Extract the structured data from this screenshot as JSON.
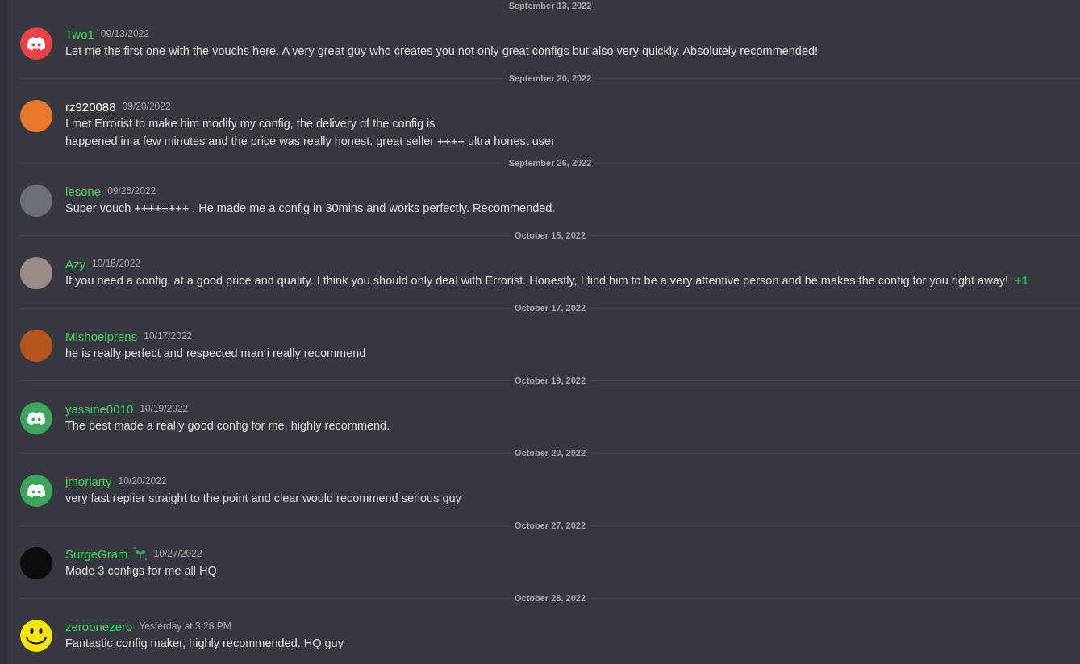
{
  "messages": [
    {
      "divider": "September 13, 2022",
      "author": "Two1",
      "color": "#43d35a",
      "timestamp": "09/13/2022",
      "avatar": {
        "kind": "discord",
        "color": "#ed4245"
      },
      "has_badge": false,
      "lines": [
        "Let me the first one with the vouchs here. A very great guy who creates you not only great configs but also very quickly. Absolutely recommended!"
      ]
    },
    {
      "divider": "September 20, 2022",
      "author": "rz920088",
      "color": "#ffffff",
      "timestamp": "09/20/2022",
      "avatar": {
        "kind": "photo",
        "color": "#e8792c"
      },
      "has_badge": false,
      "lines": [
        "I met Errorist to make him modify my config, the delivery of the config is",
        "happened in a few minutes and the price was really honest. great seller ++++ ultra honest user"
      ]
    },
    {
      "divider": "September 26, 2022",
      "author": "lesone",
      "color": "#43d35a",
      "timestamp": "09/26/2022",
      "avatar": {
        "kind": "photo",
        "color": "#6b7078"
      },
      "has_badge": false,
      "lines": [
        "Super vouch ++++++++ . He made me a config in 30mins and works perfectly. Recommended."
      ]
    },
    {
      "divider": "October 15, 2022",
      "author": "Azy",
      "color": "#43d35a",
      "timestamp": "10/15/2022",
      "avatar": {
        "kind": "photo",
        "color": "#9a8b86"
      },
      "has_badge": false,
      "lines": [
        "If you need a config, at a good price and quality. I think you should only deal with Errorist. Honestly, I find him to be a very attentive person and he makes the config for you right away!"
      ],
      "emoji": "+1"
    },
    {
      "divider": "October 17, 2022",
      "author": "Mishoelprens",
      "color": "#43d35a",
      "timestamp": "10/17/2022",
      "avatar": {
        "kind": "photo",
        "color": "#b5541c"
      },
      "has_badge": false,
      "lines": [
        "he is really perfect and respected man i really recommend"
      ]
    },
    {
      "divider": "October 19, 2022",
      "author": "yassine0010",
      "color": "#43d35a",
      "timestamp": "10/19/2022",
      "avatar": {
        "kind": "discord",
        "color": "#3ba55c"
      },
      "has_badge": false,
      "lines": [
        "The best made a really good config for me, highly recommend."
      ]
    },
    {
      "divider": "October 20, 2022",
      "author": "jmoriarty",
      "color": "#43d35a",
      "timestamp": "10/20/2022",
      "avatar": {
        "kind": "discord",
        "color": "#3ba55c"
      },
      "has_badge": false,
      "lines": [
        "very fast replier straight to the point and clear would recommend serious guy"
      ]
    },
    {
      "divider": "October 27, 2022",
      "author": "SurgeGram",
      "color": "#43d35a",
      "timestamp": "10/27/2022",
      "avatar": {
        "kind": "photo",
        "color": "#0c0c0c"
      },
      "has_badge": true,
      "lines": [
        "Made 3 configs for me all HQ"
      ]
    },
    {
      "divider": "October 28, 2022",
      "author": "zeroonezero",
      "color": "#43d35a",
      "timestamp": "Yesterday at 3:28 PM",
      "avatar": {
        "kind": "smiley",
        "color": "#f5e50a"
      },
      "has_badge": false,
      "lines": [
        "Fantastic config maker, highly recommended. HQ guy"
      ]
    }
  ]
}
